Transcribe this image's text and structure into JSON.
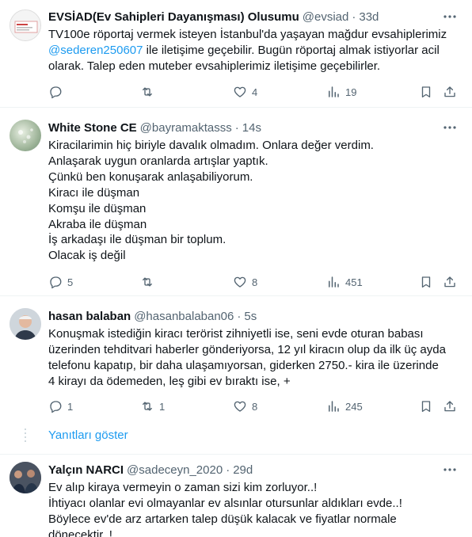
{
  "tweets": [
    {
      "name": "EVSİAD(Ev Sahipleri Dayanışması) Olusumu",
      "handle": "@evsiad",
      "time": "33d",
      "lines": [
        "TV100e röportaj vermek isteyen İstanbul'da yaşayan mağdur evsahiplerimiz",
        "@sederen250607",
        " ile iletişime geçebilir. Bugün röportaj almak istiyorlar acil",
        "olarak. Talep eden muteber evsahiplerimiz iletişime geçebilirler."
      ],
      "replies": "",
      "retweets": "",
      "likes": "4",
      "views": "19"
    },
    {
      "name": "White Stone CE",
      "handle": "@bayramaktasss",
      "time": "14s",
      "lines": [
        "Kiracilarimin hiç biriyle davalık olmadım. Onlara değer verdim.",
        "Anlaşarak uygun oranlarda artışlar yaptık.",
        "Çünkü ben konuşarak anlaşabiliyorum.",
        "Kiracı ile düşman",
        "Komşu ile düşman",
        "Akraba ile düşman",
        "İş arkadaşı ile düşman bir toplum.",
        "Olacak iş değil"
      ],
      "replies": "5",
      "retweets": "",
      "likes": "8",
      "views": "451"
    },
    {
      "name": "hasan balaban",
      "handle": "@hasanbalaban06",
      "time": "5s",
      "lines": [
        "Konuşmak istediğin kiracı terörist zihniyetli ise, seni evde oturan babası",
        "üzerinden tehditvari haberler gönderiyorsa, 12 yıl kiracın olup da ilk üç ayda",
        "telefonu kapatıp, bir daha ulaşamıyorsan,  giderken 2750.- kira ile üzerinde",
        "4 kirayı da ödemeden, leş gibi ev bıraktı ise, +"
      ],
      "replies": "1",
      "retweets": "1",
      "likes": "8",
      "views": "245"
    },
    {
      "name": "Yalçın NARCI",
      "handle": "@sadeceyn_2020",
      "time": "29d",
      "lines": [
        "Ev alıp kiraya vermeyin o zaman sizi kim zorluyor..!",
        "İhtiyacı olanlar evi olmayanlar ev alsınlar otursunlar aldıkları evde..!",
        "Böylece ev'de arz artarken talep düşük kalacak ve fiyatlar normale",
        "dönecektir..!"
      ]
    }
  ],
  "show_replies": "Yanıtları göster",
  "icons": {
    "reply": "reply-icon",
    "retweet": "retweet-icon",
    "like": "heart-icon",
    "views": "views-icon",
    "bookmark": "bookmark-icon",
    "share": "share-icon",
    "more": "more-icon"
  },
  "colors": {
    "text": "#0f1419",
    "secondary": "#536471",
    "link": "#1d9bf0",
    "separator": "#eff3f4"
  }
}
